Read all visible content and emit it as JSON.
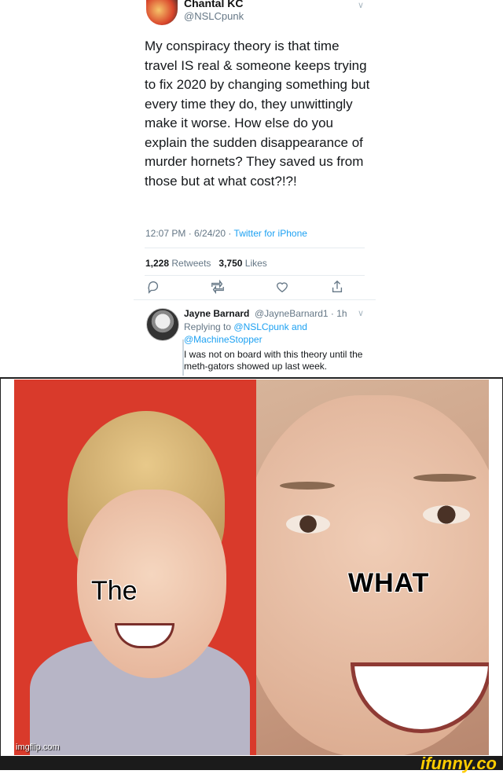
{
  "tweet": {
    "author_name": "Chantal KC",
    "author_handle": "@NSLCpunk",
    "body": "My conspiracy theory is that time travel IS real & someone keeps trying to fix 2020 by changing something but every time they do, they unwittingly make it worse. How else do you explain the sudden disappearance of murder hornets? They saved us from those but at what cost?!?!",
    "time": "12:07 PM · 6/24/20",
    "source": "Twitter for iPhone",
    "retweets_count": "1,228",
    "retweets_label": "Retweets",
    "likes_count": "3,750",
    "likes_label": "Likes"
  },
  "reply": {
    "author_name": "Jayne Barnard",
    "author_handle": "@JayneBarnard1 · 1h",
    "replying_to_label": "Replying to",
    "replying_to_handles": "@NSLCpunk and @MachineStopper",
    "body": "I was not on board with this theory until the meth-gators showed up last week."
  },
  "meme": {
    "left_caption": "The",
    "right_caption": "WHAT",
    "watermark": "imgflip.com"
  },
  "footer": {
    "brand": "ifunny.co"
  },
  "colors": {
    "link": "#1da1f2",
    "muted": "#657786",
    "brand": "#ffcc00"
  }
}
